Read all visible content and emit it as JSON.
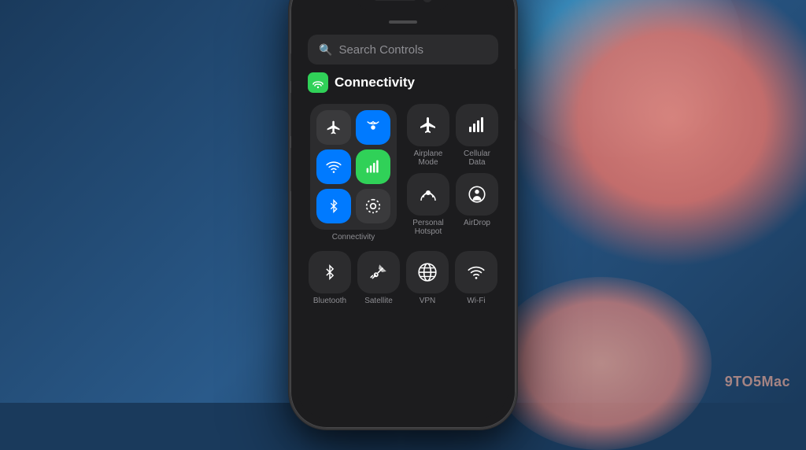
{
  "background": {
    "base_color": "#1a3a5c"
  },
  "watermark": {
    "text": "9TO5Mac"
  },
  "phone": {
    "search_bar": {
      "placeholder": "Search Controls"
    },
    "section": {
      "title": "Connectivity",
      "icon": "📶"
    },
    "connectivity_cluster": {
      "cells": [
        {
          "id": "airplane",
          "icon": "✈",
          "style": "gray"
        },
        {
          "id": "wifi-hotspot",
          "icon": "📡",
          "style": "blue"
        },
        {
          "id": "wifi",
          "icon": "📶",
          "style": "blue"
        },
        {
          "id": "cellular",
          "icon": "📊",
          "style": "blue"
        },
        {
          "id": "bluetooth-small",
          "icon": "✱",
          "style": "blue"
        },
        {
          "id": "airdrop-small",
          "icon": "↗",
          "style": "gray"
        }
      ],
      "label": "Connectivity"
    },
    "right_controls": [
      {
        "id": "airplane-mode",
        "icon": "✈",
        "label": "Airplane Mode"
      },
      {
        "id": "cellular-data",
        "icon": "📶",
        "label": "Cellular Data"
      },
      {
        "id": "personal-hotspot",
        "icon": "📡",
        "label": "Personal\nHotspot"
      },
      {
        "id": "airdrop",
        "icon": "↗",
        "label": "AirDrop"
      }
    ],
    "bottom_controls": [
      {
        "id": "bluetooth",
        "icon": "✱",
        "label": "Bluetooth"
      },
      {
        "id": "satellite",
        "icon": "📡",
        "label": "Satellite"
      },
      {
        "id": "vpn",
        "icon": "🌐",
        "label": "VPN"
      },
      {
        "id": "wifi-bottom",
        "icon": "📶",
        "label": "Wi-Fi"
      }
    ]
  }
}
